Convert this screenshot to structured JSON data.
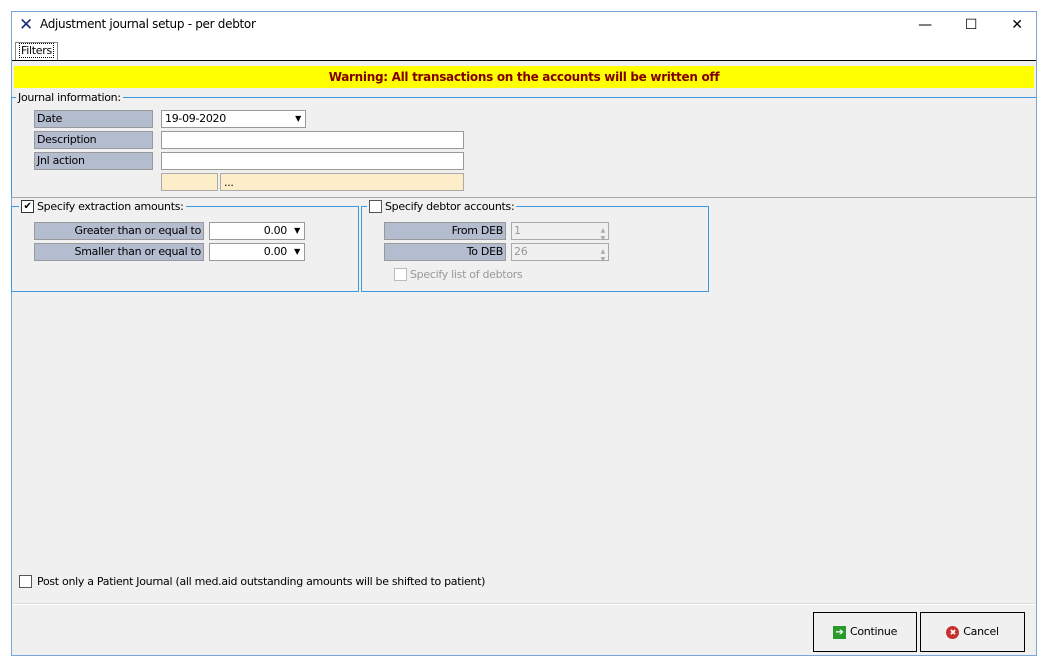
{
  "window": {
    "title": "Adjustment journal setup - per debtor",
    "minimize": "—",
    "maximize": "☐",
    "close": "✕"
  },
  "tabs": [
    {
      "label": "Filters"
    }
  ],
  "warning": "Warning:  All transactions on the accounts will be written off",
  "journal": {
    "legend": "Journal information:",
    "date_label": "Date",
    "date_value": "19-09-2020",
    "description_label": "Description",
    "description_value": "",
    "jnl_action_label": "Jnl action",
    "jnl_action_value": "",
    "lookup_code": "",
    "lookup_value": "..."
  },
  "extraction": {
    "legend": "Specify extraction amounts:",
    "checked": true,
    "gte_label": "Greater than or equal to",
    "gte_value": "0.00",
    "lte_label": "Smaller than or equal to",
    "lte_value": "0.00"
  },
  "debtors": {
    "legend": "Specify debtor accounts:",
    "checked": false,
    "from_label": "From DEB",
    "from_value": "1",
    "to_label": "To DEB",
    "to_value": "26",
    "list_label": "Specify list of debtors"
  },
  "patient_journal": {
    "label": "Post only a Patient Journal (all med.aid outstanding amounts will be shifted to patient)",
    "checked": false
  },
  "buttons": {
    "continue": "Continue",
    "cancel": "Cancel"
  }
}
